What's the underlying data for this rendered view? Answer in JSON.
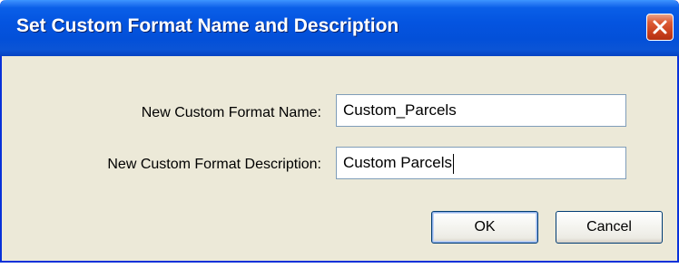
{
  "dialog": {
    "title": "Set Custom Format Name and Description",
    "close_icon": "close-icon"
  },
  "form": {
    "name_label": "New Custom Format Name:",
    "name_value": "Custom_Parcels",
    "description_label": "New Custom Format Description:",
    "description_value": "Custom Parcels"
  },
  "buttons": {
    "ok_label": "OK",
    "cancel_label": "Cancel"
  },
  "colors": {
    "titlebar": "#0454e0",
    "dialog_background": "#ece9d8",
    "close_button": "#dd5c36"
  }
}
